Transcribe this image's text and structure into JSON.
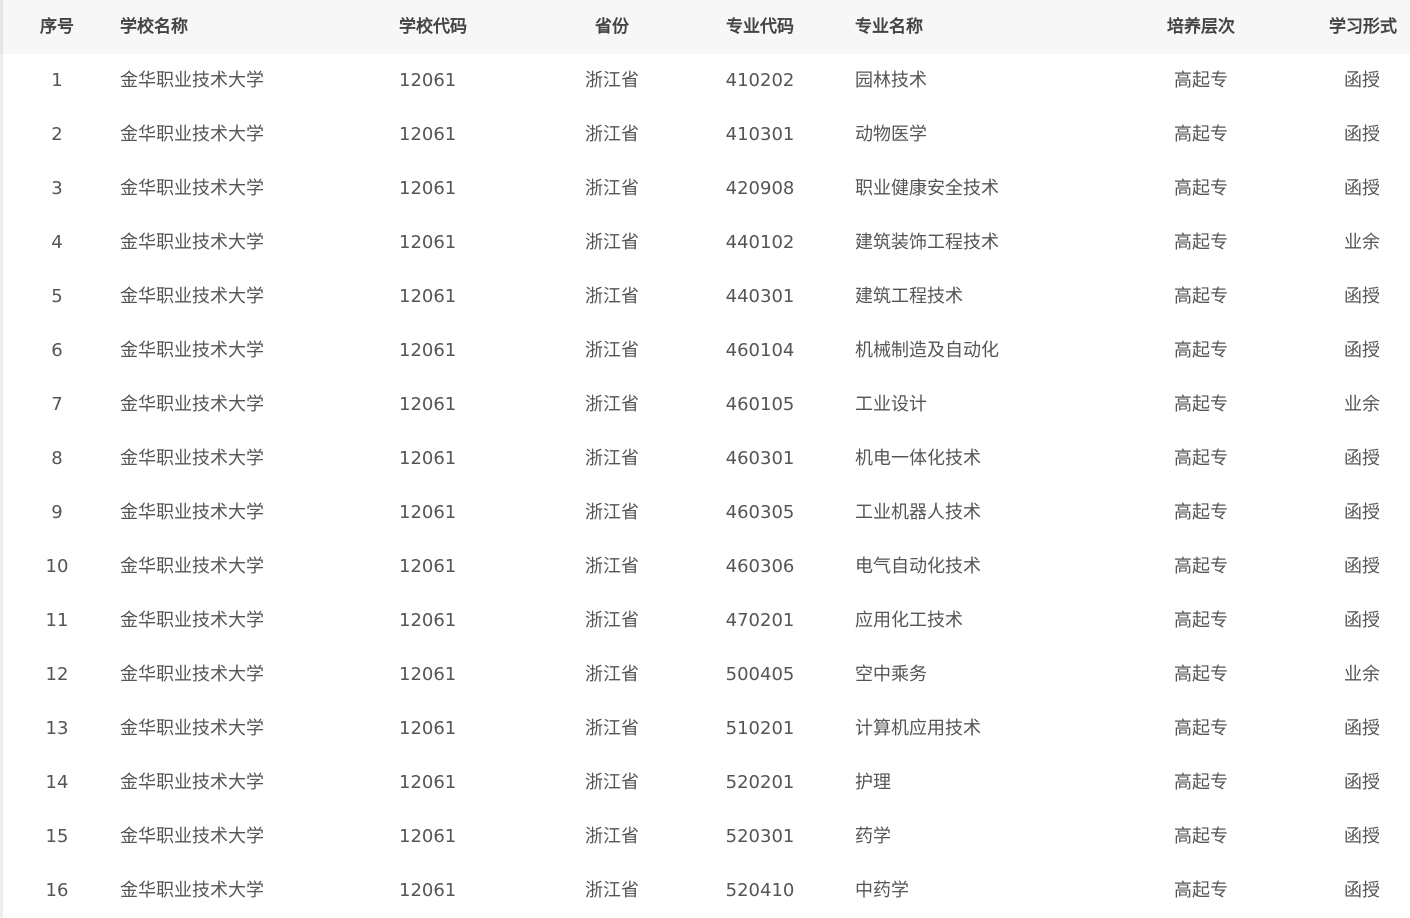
{
  "headers": {
    "index": "序号",
    "school_name": "学校名称",
    "school_code": "学校代码",
    "province": "省份",
    "major_code": "专业代码",
    "major_name": "专业名称",
    "level": "培养层次",
    "study_form": "学习形式"
  },
  "rows": [
    {
      "index": "1",
      "school_name": "金华职业技术大学",
      "school_code": "12061",
      "province": "浙江省",
      "major_code": "410202",
      "major_name": "园林技术",
      "level": "高起专",
      "study_form": "函授"
    },
    {
      "index": "2",
      "school_name": "金华职业技术大学",
      "school_code": "12061",
      "province": "浙江省",
      "major_code": "410301",
      "major_name": "动物医学",
      "level": "高起专",
      "study_form": "函授"
    },
    {
      "index": "3",
      "school_name": "金华职业技术大学",
      "school_code": "12061",
      "province": "浙江省",
      "major_code": "420908",
      "major_name": "职业健康安全技术",
      "level": "高起专",
      "study_form": "函授"
    },
    {
      "index": "4",
      "school_name": "金华职业技术大学",
      "school_code": "12061",
      "province": "浙江省",
      "major_code": "440102",
      "major_name": "建筑装饰工程技术",
      "level": "高起专",
      "study_form": "业余"
    },
    {
      "index": "5",
      "school_name": "金华职业技术大学",
      "school_code": "12061",
      "province": "浙江省",
      "major_code": "440301",
      "major_name": "建筑工程技术",
      "level": "高起专",
      "study_form": "函授"
    },
    {
      "index": "6",
      "school_name": "金华职业技术大学",
      "school_code": "12061",
      "province": "浙江省",
      "major_code": "460104",
      "major_name": "机械制造及自动化",
      "level": "高起专",
      "study_form": "函授"
    },
    {
      "index": "7",
      "school_name": "金华职业技术大学",
      "school_code": "12061",
      "province": "浙江省",
      "major_code": "460105",
      "major_name": "工业设计",
      "level": "高起专",
      "study_form": "业余"
    },
    {
      "index": "8",
      "school_name": "金华职业技术大学",
      "school_code": "12061",
      "province": "浙江省",
      "major_code": "460301",
      "major_name": "机电一体化技术",
      "level": "高起专",
      "study_form": "函授"
    },
    {
      "index": "9",
      "school_name": "金华职业技术大学",
      "school_code": "12061",
      "province": "浙江省",
      "major_code": "460305",
      "major_name": "工业机器人技术",
      "level": "高起专",
      "study_form": "函授"
    },
    {
      "index": "10",
      "school_name": "金华职业技术大学",
      "school_code": "12061",
      "province": "浙江省",
      "major_code": "460306",
      "major_name": "电气自动化技术",
      "level": "高起专",
      "study_form": "函授"
    },
    {
      "index": "11",
      "school_name": "金华职业技术大学",
      "school_code": "12061",
      "province": "浙江省",
      "major_code": "470201",
      "major_name": "应用化工技术",
      "level": "高起专",
      "study_form": "函授"
    },
    {
      "index": "12",
      "school_name": "金华职业技术大学",
      "school_code": "12061",
      "province": "浙江省",
      "major_code": "500405",
      "major_name": "空中乘务",
      "level": "高起专",
      "study_form": "业余"
    },
    {
      "index": "13",
      "school_name": "金华职业技术大学",
      "school_code": "12061",
      "province": "浙江省",
      "major_code": "510201",
      "major_name": "计算机应用技术",
      "level": "高起专",
      "study_form": "函授"
    },
    {
      "index": "14",
      "school_name": "金华职业技术大学",
      "school_code": "12061",
      "province": "浙江省",
      "major_code": "520201",
      "major_name": "护理",
      "level": "高起专",
      "study_form": "函授"
    },
    {
      "index": "15",
      "school_name": "金华职业技术大学",
      "school_code": "12061",
      "province": "浙江省",
      "major_code": "520301",
      "major_name": "药学",
      "level": "高起专",
      "study_form": "函授"
    },
    {
      "index": "16",
      "school_name": "金华职业技术大学",
      "school_code": "12061",
      "province": "浙江省",
      "major_code": "520410",
      "major_name": "中药学",
      "level": "高起专",
      "study_form": "函授"
    }
  ]
}
